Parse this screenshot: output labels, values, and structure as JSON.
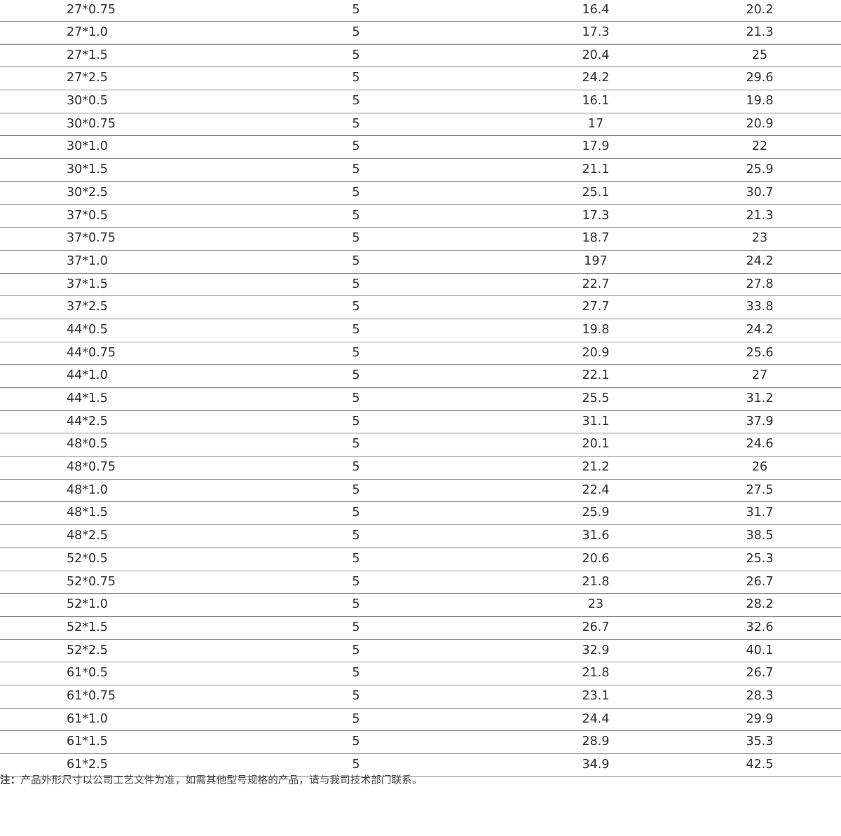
{
  "table": {
    "rows": [
      [
        "27*0.75",
        "5",
        "16.4",
        "20.2"
      ],
      [
        "27*1.0",
        "5",
        "17.3",
        "21.3"
      ],
      [
        "27*1.5",
        "5",
        "20.4",
        "25"
      ],
      [
        "27*2.5",
        "5",
        "24.2",
        "29.6"
      ],
      [
        "30*0.5",
        "5",
        "16.1",
        "19.8"
      ],
      [
        "30*0.75",
        "5",
        "17",
        "20.9"
      ],
      [
        "30*1.0",
        "5",
        "17.9",
        "22"
      ],
      [
        "30*1.5",
        "5",
        "21.1",
        "25.9"
      ],
      [
        "30*2.5",
        "5",
        "25.1",
        "30.7"
      ],
      [
        "37*0.5",
        "5",
        "17.3",
        "21.3"
      ],
      [
        "37*0.75",
        "5",
        "18.7",
        "23"
      ],
      [
        "37*1.0",
        "5",
        "197",
        "24.2"
      ],
      [
        "37*1.5",
        "5",
        "22.7",
        "27.8"
      ],
      [
        "37*2.5",
        "5",
        "27.7",
        "33.8"
      ],
      [
        "44*0.5",
        "5",
        "19.8",
        "24.2"
      ],
      [
        "44*0.75",
        "5",
        "20.9",
        "25.6"
      ],
      [
        "44*1.0",
        "5",
        "22.1",
        "27"
      ],
      [
        "44*1.5",
        "5",
        "25.5",
        "31.2"
      ],
      [
        "44*2.5",
        "5",
        "31.1",
        "37.9"
      ],
      [
        "48*0.5",
        "5",
        "20.1",
        "24.6"
      ],
      [
        "48*0.75",
        "5",
        "21.2",
        "26"
      ],
      [
        "48*1.0",
        "5",
        "22.4",
        "27.5"
      ],
      [
        "48*1.5",
        "5",
        "25.9",
        "31.7"
      ],
      [
        "48*2.5",
        "5",
        "31.6",
        "38.5"
      ],
      [
        "52*0.5",
        "5",
        "20.6",
        "25.3"
      ],
      [
        "52*0.75",
        "5",
        "21.8",
        "26.7"
      ],
      [
        "52*1.0",
        "5",
        "23",
        "28.2"
      ],
      [
        "52*1.5",
        "5",
        "26.7",
        "32.6"
      ],
      [
        "52*2.5",
        "5",
        "32.9",
        "40.1"
      ],
      [
        "61*0.5",
        "5",
        "21.8",
        "26.7"
      ],
      [
        "61*0.75",
        "5",
        "23.1",
        "28.3"
      ],
      [
        "61*1.0",
        "5",
        "24.4",
        "29.9"
      ],
      [
        "61*1.5",
        "5",
        "28.9",
        "35.3"
      ],
      [
        "61*2.5",
        "5",
        "34.9",
        "42.5"
      ]
    ]
  },
  "note": {
    "label": "注：",
    "text": "产品外形尺寸以公司工艺文件为准，如需其他型号规格的产品，请与我司技术部门联系。"
  }
}
